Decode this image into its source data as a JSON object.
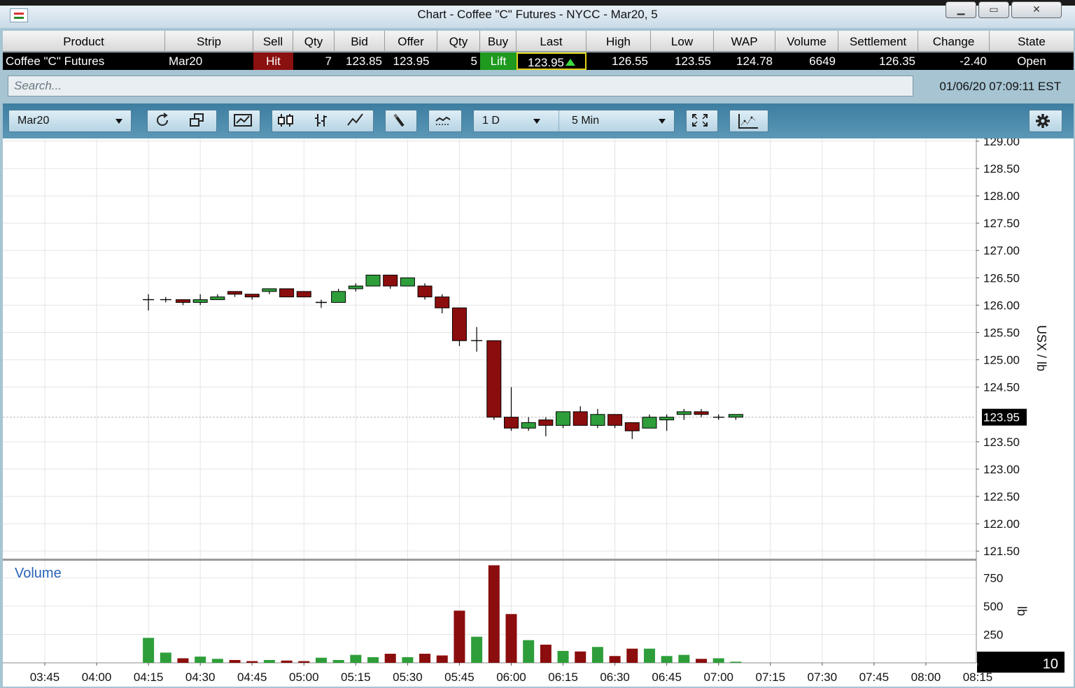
{
  "window": {
    "title": "Chart - Coffee \"C\" Futures - NYCC - Mar20, 5"
  },
  "quote": {
    "headers": [
      "Product",
      "Strip",
      "Sell",
      "Qty",
      "Bid",
      "Offer",
      "Qty",
      "Buy",
      "Last",
      "High",
      "Low",
      "WAP",
      "Volume",
      "Settlement",
      "Change",
      "State"
    ],
    "row": {
      "product": "Coffee \"C\" Futures",
      "strip": "Mar20",
      "sell": "Hit",
      "bid_qty": "7",
      "bid": "123.85",
      "offer": "123.95",
      "offer_qty": "5",
      "buy": "Lift",
      "last": "123.95",
      "high": "126.55",
      "low": "123.55",
      "wap": "124.78",
      "volume": "6649",
      "settlement": "126.35",
      "change": "-2.40",
      "state": "Open"
    }
  },
  "search": {
    "placeholder": "Search...",
    "datetime": "01/06/20 07:09:11 EST"
  },
  "toolbar": {
    "contract": "Mar20",
    "range": "1 D",
    "interval": "5 Min"
  },
  "colors": {
    "up": "#2e9e3a",
    "down": "#8b0d0d",
    "grid": "#e4e4e4",
    "toolbar": "#4a89ab"
  },
  "chart_data": {
    "type": "candlestick",
    "ylabel": "USX / lb",
    "volume_label": "Volume",
    "volume_unit": "lb",
    "last_price_label": "123.95",
    "volume_scale_label": "10",
    "price_ticks": [
      "129.00",
      "128.50",
      "128.00",
      "127.50",
      "127.00",
      "126.50",
      "126.00",
      "125.50",
      "125.00",
      "124.50",
      "123.50",
      "123.00",
      "122.50",
      "122.00",
      "121.50"
    ],
    "volume_ticks": [
      "750",
      "500",
      "250"
    ],
    "time_ticks": [
      "03:45",
      "04:00",
      "04:15",
      "04:30",
      "04:45",
      "05:00",
      "05:15",
      "05:30",
      "05:45",
      "06:00",
      "06:15",
      "06:30",
      "06:45",
      "07:00",
      "07:15",
      "07:30",
      "07:45",
      "08:00",
      "08:15"
    ],
    "ylim": [
      121.4,
      129.05
    ],
    "volume_max": 900,
    "last_price": 123.95,
    "candles": [
      {
        "t": "04:15",
        "o": 126.1,
        "h": 126.2,
        "l": 125.9,
        "c": 126.1,
        "v": 220
      },
      {
        "t": "04:20",
        "o": 126.1,
        "h": 126.15,
        "l": 126.05,
        "c": 126.1,
        "v": 90
      },
      {
        "t": "04:25",
        "o": 126.1,
        "h": 126.1,
        "l": 126.0,
        "c": 126.05,
        "v": 40
      },
      {
        "t": "04:30",
        "o": 126.05,
        "h": 126.2,
        "l": 126.0,
        "c": 126.1,
        "v": 55
      },
      {
        "t": "04:35",
        "o": 126.1,
        "h": 126.2,
        "l": 126.1,
        "c": 126.15,
        "v": 35
      },
      {
        "t": "04:40",
        "o": 126.25,
        "h": 126.25,
        "l": 126.15,
        "c": 126.2,
        "v": 25
      },
      {
        "t": "04:45",
        "o": 126.2,
        "h": 126.2,
        "l": 126.1,
        "c": 126.15,
        "v": 15
      },
      {
        "t": "04:50",
        "o": 126.25,
        "h": 126.3,
        "l": 126.2,
        "c": 126.3,
        "v": 25
      },
      {
        "t": "04:55",
        "o": 126.3,
        "h": 126.3,
        "l": 126.15,
        "c": 126.15,
        "v": 20
      },
      {
        "t": "05:00",
        "o": 126.25,
        "h": 126.25,
        "l": 126.15,
        "c": 126.15,
        "v": 15
      },
      {
        "t": "05:05",
        "o": 126.05,
        "h": 126.1,
        "l": 125.95,
        "c": 126.05,
        "v": 45
      },
      {
        "t": "05:10",
        "o": 126.05,
        "h": 126.3,
        "l": 126.05,
        "c": 126.25,
        "v": 25
      },
      {
        "t": "05:15",
        "o": 126.3,
        "h": 126.4,
        "l": 126.25,
        "c": 126.35,
        "v": 70
      },
      {
        "t": "05:20",
        "o": 126.35,
        "h": 126.55,
        "l": 126.35,
        "c": 126.55,
        "v": 50
      },
      {
        "t": "05:25",
        "o": 126.55,
        "h": 126.55,
        "l": 126.3,
        "c": 126.35,
        "v": 80
      },
      {
        "t": "05:30",
        "o": 126.35,
        "h": 126.5,
        "l": 126.35,
        "c": 126.5,
        "v": 50
      },
      {
        "t": "05:35",
        "o": 126.35,
        "h": 126.4,
        "l": 126.1,
        "c": 126.15,
        "v": 80
      },
      {
        "t": "05:40",
        "o": 126.15,
        "h": 126.2,
        "l": 125.85,
        "c": 125.95,
        "v": 65
      },
      {
        "t": "05:45",
        "o": 125.95,
        "h": 125.95,
        "l": 125.25,
        "c": 125.35,
        "v": 460
      },
      {
        "t": "05:50",
        "o": 125.35,
        "h": 125.6,
        "l": 125.15,
        "c": 125.35,
        "v": 230
      },
      {
        "t": "05:55",
        "o": 125.35,
        "h": 125.35,
        "l": 123.9,
        "c": 123.95,
        "v": 860
      },
      {
        "t": "06:00",
        "o": 123.95,
        "h": 124.5,
        "l": 123.7,
        "c": 123.75,
        "v": 430
      },
      {
        "t": "06:05",
        "o": 123.75,
        "h": 123.95,
        "l": 123.7,
        "c": 123.85,
        "v": 200
      },
      {
        "t": "06:10",
        "o": 123.9,
        "h": 123.95,
        "l": 123.6,
        "c": 123.8,
        "v": 160
      },
      {
        "t": "06:15",
        "o": 123.8,
        "h": 124.05,
        "l": 123.75,
        "c": 124.05,
        "v": 105
      },
      {
        "t": "06:20",
        "o": 124.05,
        "h": 124.15,
        "l": 123.8,
        "c": 123.8,
        "v": 100
      },
      {
        "t": "06:25",
        "o": 123.8,
        "h": 124.1,
        "l": 123.75,
        "c": 124.0,
        "v": 140
      },
      {
        "t": "06:30",
        "o": 124.0,
        "h": 124.0,
        "l": 123.75,
        "c": 123.8,
        "v": 60
      },
      {
        "t": "06:35",
        "o": 123.85,
        "h": 123.85,
        "l": 123.55,
        "c": 123.7,
        "v": 125
      },
      {
        "t": "06:40",
        "o": 123.75,
        "h": 124.0,
        "l": 123.75,
        "c": 123.95,
        "v": 125
      },
      {
        "t": "06:45",
        "o": 123.9,
        "h": 124.0,
        "l": 123.7,
        "c": 123.95,
        "v": 60
      },
      {
        "t": "06:50",
        "o": 124.0,
        "h": 124.1,
        "l": 123.9,
        "c": 124.05,
        "v": 70
      },
      {
        "t": "06:55",
        "o": 124.05,
        "h": 124.1,
        "l": 123.95,
        "c": 124.0,
        "v": 35
      },
      {
        "t": "07:00",
        "o": 123.95,
        "h": 124.0,
        "l": 123.9,
        "c": 123.95,
        "v": 40
      },
      {
        "t": "07:05",
        "o": 123.95,
        "h": 124.0,
        "l": 123.9,
        "c": 124.0,
        "v": 10
      }
    ]
  }
}
